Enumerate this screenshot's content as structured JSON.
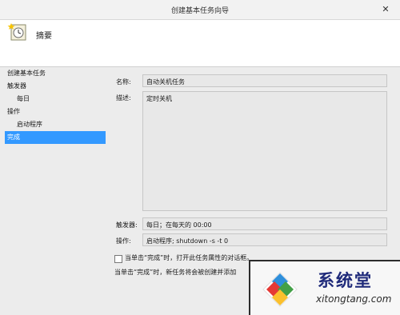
{
  "window": {
    "title": "创建基本任务向导",
    "close_glyph": "✕"
  },
  "header": {
    "title": "摘要",
    "icon": "task-clock-icon"
  },
  "nav": {
    "items": [
      {
        "label": "创建基本任务",
        "sub": false,
        "selected": false
      },
      {
        "label": "触发器",
        "sub": false,
        "selected": false
      },
      {
        "label": "每日",
        "sub": true,
        "selected": false
      },
      {
        "label": "操作",
        "sub": false,
        "selected": false
      },
      {
        "label": "启动程序",
        "sub": true,
        "selected": false
      },
      {
        "label": "完成",
        "sub": false,
        "selected": true
      }
    ]
  },
  "summary": {
    "name_label": "名称:",
    "name_value": "自动关机任务",
    "desc_label": "描述:",
    "desc_value": "定时关机",
    "trigger_label": "触发器:",
    "trigger_value": "每日；在每天的 00:00",
    "action_label": "操作:",
    "action_value": "启动程序; shutdown -s -t 0"
  },
  "open_properties": {
    "checked": false,
    "label": "当单击“完成”时，打开此任务属性的对话框。"
  },
  "info_text": "当单击“完成”时，新任务将会被创建并添加",
  "watermark": {
    "brand": "系统堂",
    "url": "xitongtang.com"
  }
}
